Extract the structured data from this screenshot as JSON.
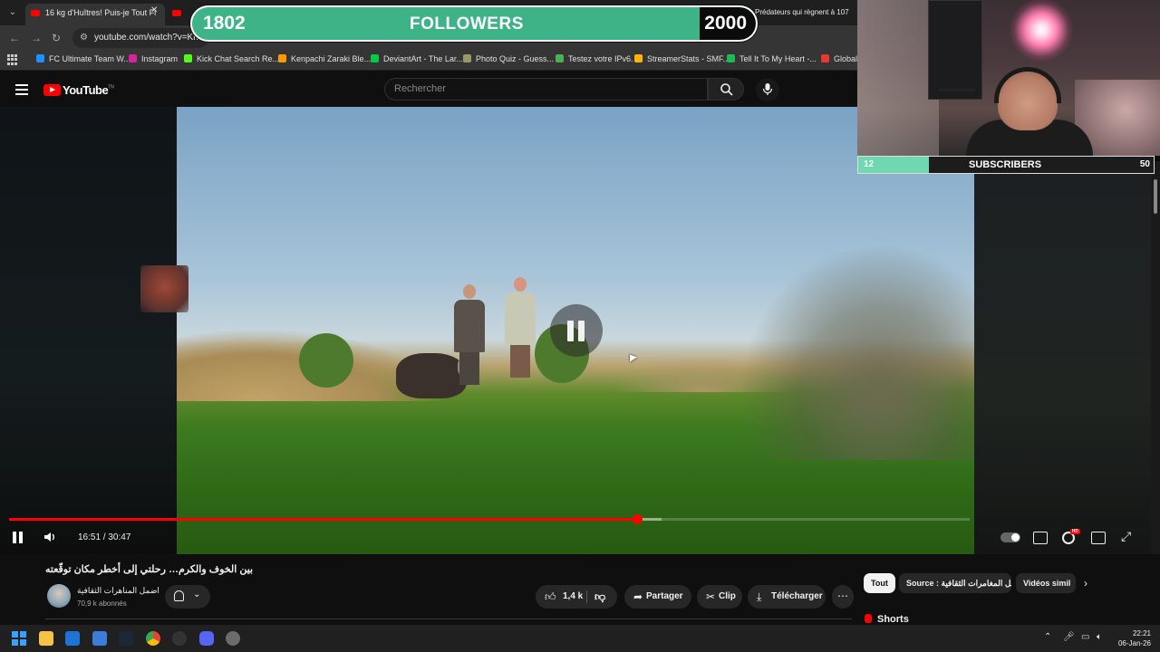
{
  "browser": {
    "tabs": [
      {
        "title": "16 kg d'Huîtres! Puis-je Tout Fi"
      },
      {
        "title": "Prédateurs qui règnent à 107"
      }
    ],
    "url": "youtube.com/watch?v=Km",
    "misc_label": "巨大",
    "bookmarks": [
      {
        "label": "FC Ultimate Team W...",
        "color": "#1e90ff"
      },
      {
        "label": "Instagram",
        "color": "#d6249f"
      },
      {
        "label": "Kick Chat Search Re...",
        "color": "#53fc18"
      },
      {
        "label": "Kenpachi Zaraki Ble...",
        "color": "#ff9900"
      },
      {
        "label": "DeviantArt - The Lar...",
        "color": "#05cc47"
      },
      {
        "label": "Photo Quiz - Guess...",
        "color": "#999966"
      },
      {
        "label": "Testez votre IPv6.",
        "color": "#4caf50"
      },
      {
        "label": "StreamerStats - SMF...",
        "color": "#ffb300"
      },
      {
        "label": "Tell It To My Heart -...",
        "color": "#1db954"
      },
      {
        "label": "GlobalN",
        "color": "#e53935"
      }
    ]
  },
  "youtube": {
    "logo_text": "YouTube",
    "logo_tm": "TN",
    "search_placeholder": "Rechercher"
  },
  "player": {
    "time": "16:51 / 30:47",
    "progress": 0.654,
    "loaded": 0.679,
    "gear_badge": "HD"
  },
  "video_info": {
    "title": "بين الخوف والكرم… رحلتي إلى أخطر مكان توقّعته",
    "channel": "اضمل المناهرات الثقافية",
    "subscribers": "70,9 k abonnés",
    "likes": "1,4 k",
    "share": "Partager",
    "clip": "Clip",
    "download": "Télécharger"
  },
  "chips": [
    {
      "label": "Tout",
      "active": true
    },
    {
      "label": "Source : افضل المغامرات الثقافية",
      "active": false
    },
    {
      "label": "Vidéos simil",
      "active": false
    }
  ],
  "sidebar": {
    "shorts": "Shorts"
  },
  "overlays": {
    "followers": {
      "current": "1802",
      "label": "FOLLOWERS",
      "goal": "2000",
      "fraction": 0.901
    },
    "subscribers": {
      "current": "12",
      "label": "SUBSCRIBERS",
      "goal": "50",
      "fraction": 0.24
    }
  },
  "taskbar": {
    "time": "22:21",
    "date": "06-Jan-26"
  },
  "colors": {
    "accent": "#ff0000",
    "followers_fill": "#3fb388",
    "subs_fill": "#6fd8b0"
  }
}
